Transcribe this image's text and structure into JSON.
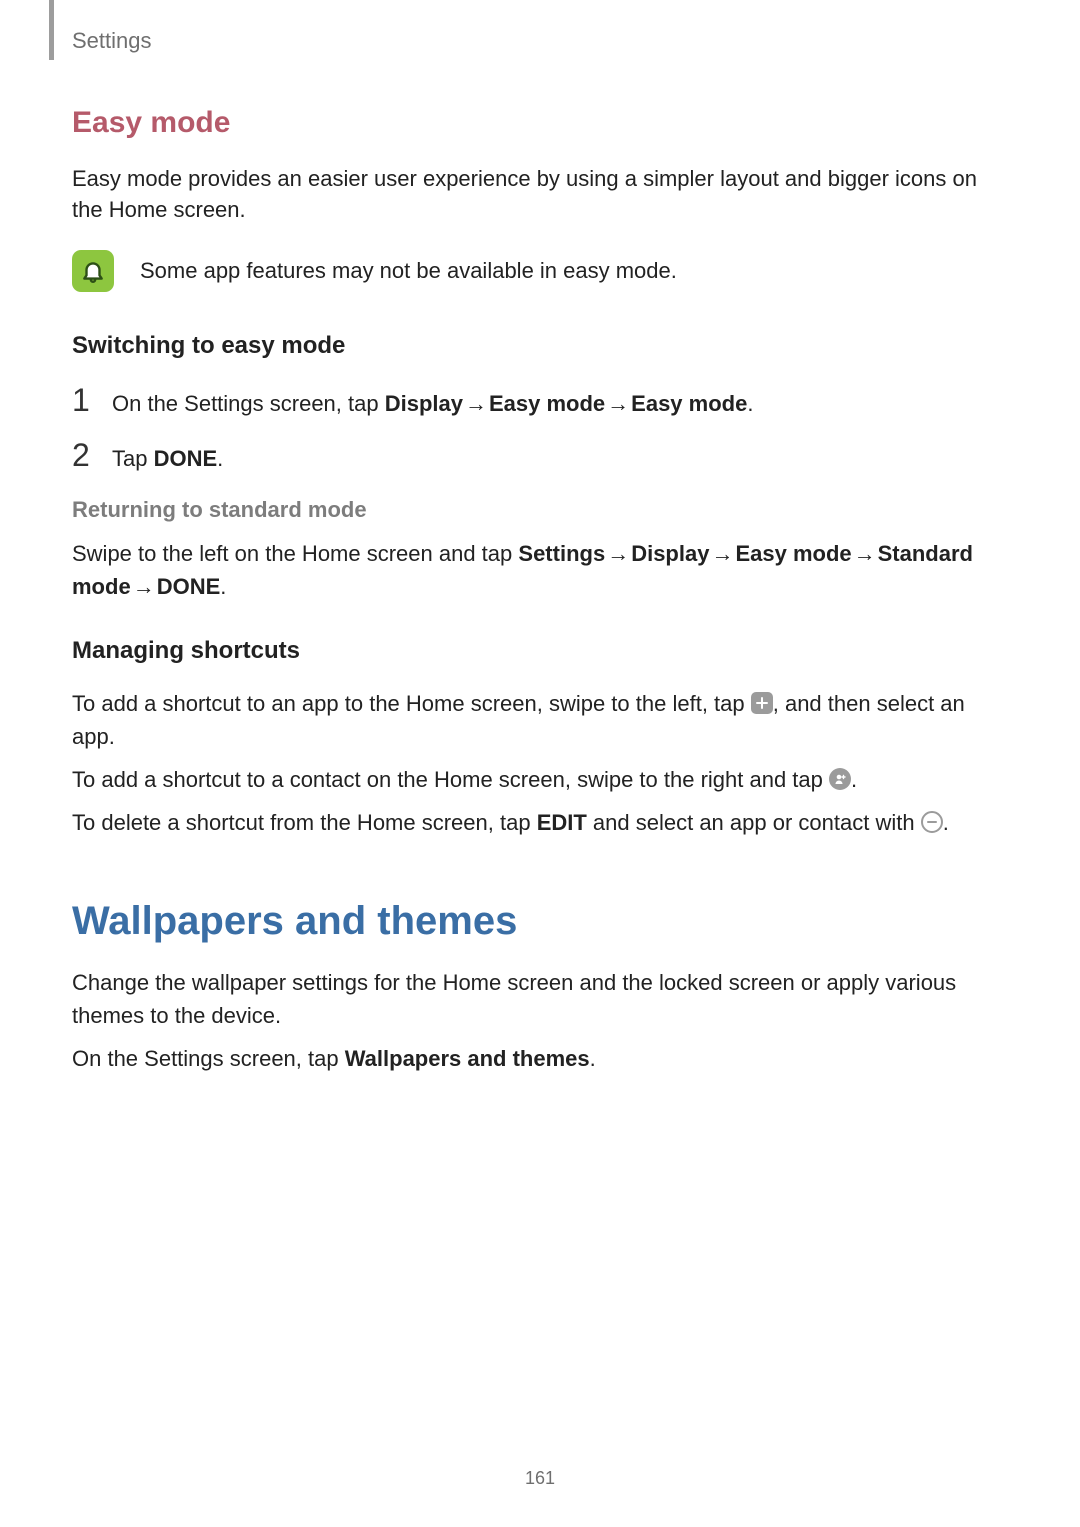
{
  "header": {
    "breadcrumb": "Settings"
  },
  "easy_mode": {
    "title": "Easy mode",
    "intro": "Easy mode provides an easier user experience by using a simpler layout and bigger icons on the Home screen.",
    "callout": "Some app features may not be available in easy mode.",
    "switching": {
      "heading": "Switching to easy mode",
      "step1_prefix": "On the Settings screen, tap ",
      "step1_path1": "Display",
      "step1_path2": "Easy mode",
      "step1_path3": "Easy mode",
      "step2_prefix": "Tap ",
      "step2_bold": "DONE",
      "step2_suffix": "."
    },
    "returning": {
      "heading": "Returning to standard mode",
      "text_prefix": "Swipe to the left on the Home screen and tap ",
      "p1": "Settings",
      "p2": "Display",
      "p3": "Easy mode",
      "p4": "Standard mode",
      "p5": "DONE",
      "suffix": "."
    },
    "managing": {
      "heading": "Managing shortcuts",
      "line1_a": "To add a shortcut to an app to the Home screen, swipe to the left, tap ",
      "line1_b": ", and then select an app.",
      "line2_a": "To add a shortcut to a contact on the Home screen, swipe to the right and tap ",
      "line2_b": ".",
      "line3_a": "To delete a shortcut from the Home screen, tap ",
      "line3_bold": "EDIT",
      "line3_b": " and select an app or contact with ",
      "line3_c": "."
    }
  },
  "wallpapers": {
    "title": "Wallpapers and themes",
    "p1": "Change the wallpaper settings for the Home screen and the locked screen or apply various themes to the device.",
    "p2_prefix": "On the Settings screen, tap ",
    "p2_bold": "Wallpapers and themes",
    "p2_suffix": "."
  },
  "arrow": "→",
  "page_number": "161"
}
